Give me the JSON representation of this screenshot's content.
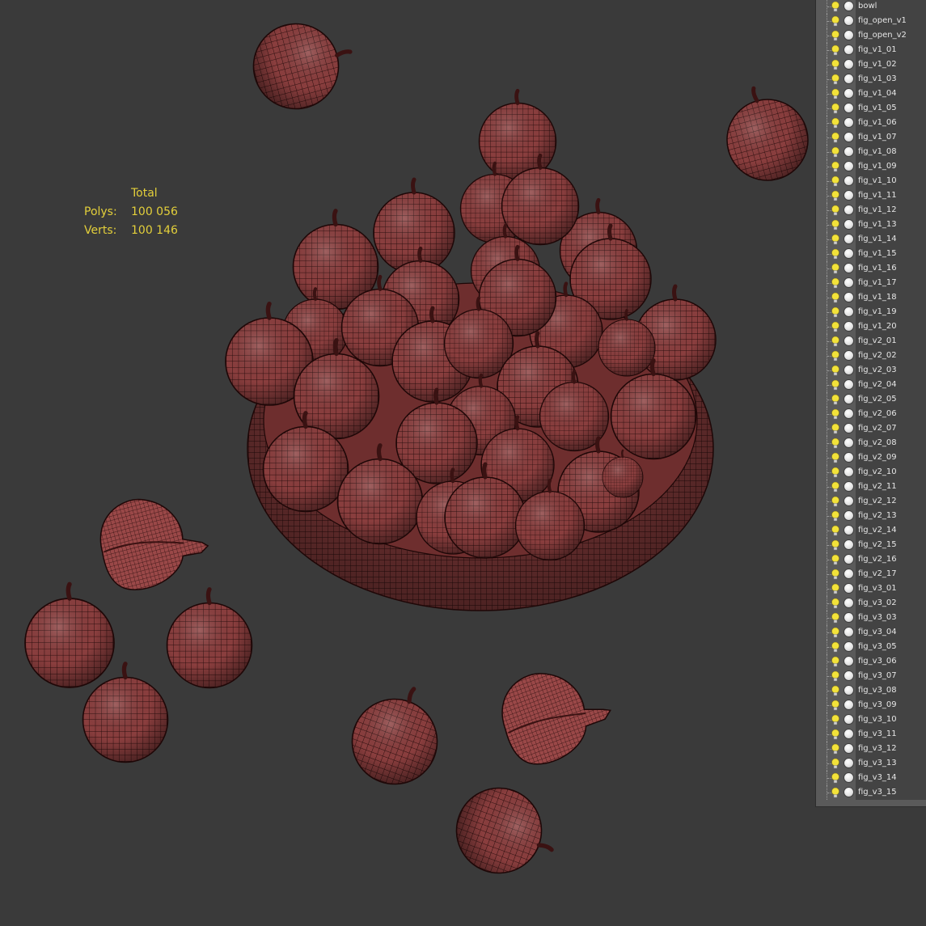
{
  "stats": {
    "header": "Total",
    "polys_label": "Polys:",
    "polys_value": "100 056",
    "verts_label": "Verts:",
    "verts_value": "100 146"
  },
  "colors": {
    "background": "#3a3a3a",
    "stats_text": "#e3cf3a",
    "wire_fill": "#8a3e3e",
    "wire_line": "#2a0d0d",
    "bulb": "#f2e23a"
  },
  "layers": [
    {
      "name": "bowl",
      "icon": "bulb-icon",
      "visible": true
    },
    {
      "name": "fig_open_v1",
      "icon": "bulb-icon",
      "visible": true
    },
    {
      "name": "fig_open_v2",
      "icon": "bulb-icon",
      "visible": true
    },
    {
      "name": "fig_v1_01",
      "icon": "bulb-icon",
      "visible": true
    },
    {
      "name": "fig_v1_02",
      "icon": "bulb-icon",
      "visible": true
    },
    {
      "name": "fig_v1_03",
      "icon": "bulb-icon",
      "visible": true
    },
    {
      "name": "fig_v1_04",
      "icon": "bulb-icon",
      "visible": true
    },
    {
      "name": "fig_v1_05",
      "icon": "bulb-icon",
      "visible": true
    },
    {
      "name": "fig_v1_06",
      "icon": "bulb-icon",
      "visible": true
    },
    {
      "name": "fig_v1_07",
      "icon": "bulb-icon",
      "visible": true
    },
    {
      "name": "fig_v1_08",
      "icon": "bulb-icon",
      "visible": true
    },
    {
      "name": "fig_v1_09",
      "icon": "bulb-icon",
      "visible": true
    },
    {
      "name": "fig_v1_10",
      "icon": "bulb-icon",
      "visible": true
    },
    {
      "name": "fig_v1_11",
      "icon": "bulb-icon",
      "visible": true
    },
    {
      "name": "fig_v1_12",
      "icon": "bulb-icon",
      "visible": true
    },
    {
      "name": "fig_v1_13",
      "icon": "bulb-icon",
      "visible": true
    },
    {
      "name": "fig_v1_14",
      "icon": "bulb-icon",
      "visible": true
    },
    {
      "name": "fig_v1_15",
      "icon": "bulb-icon",
      "visible": true
    },
    {
      "name": "fig_v1_16",
      "icon": "bulb-icon",
      "visible": true
    },
    {
      "name": "fig_v1_17",
      "icon": "bulb-icon",
      "visible": true
    },
    {
      "name": "fig_v1_18",
      "icon": "bulb-icon",
      "visible": true
    },
    {
      "name": "fig_v1_19",
      "icon": "bulb-icon",
      "visible": true
    },
    {
      "name": "fig_v1_20",
      "icon": "bulb-icon",
      "visible": true
    },
    {
      "name": "fig_v2_01",
      "icon": "bulb-icon",
      "visible": true
    },
    {
      "name": "fig_v2_02",
      "icon": "bulb-icon",
      "visible": true
    },
    {
      "name": "fig_v2_03",
      "icon": "bulb-icon",
      "visible": true
    },
    {
      "name": "fig_v2_04",
      "icon": "bulb-icon",
      "visible": true
    },
    {
      "name": "fig_v2_05",
      "icon": "bulb-icon",
      "visible": true
    },
    {
      "name": "fig_v2_06",
      "icon": "bulb-icon",
      "visible": true
    },
    {
      "name": "fig_v2_07",
      "icon": "bulb-icon",
      "visible": true
    },
    {
      "name": "fig_v2_08",
      "icon": "bulb-icon",
      "visible": true
    },
    {
      "name": "fig_v2_09",
      "icon": "bulb-icon",
      "visible": true
    },
    {
      "name": "fig_v2_10",
      "icon": "bulb-icon",
      "visible": true
    },
    {
      "name": "fig_v2_11",
      "icon": "bulb-icon",
      "visible": true
    },
    {
      "name": "fig_v2_12",
      "icon": "bulb-icon",
      "visible": true
    },
    {
      "name": "fig_v2_13",
      "icon": "bulb-icon",
      "visible": true
    },
    {
      "name": "fig_v2_14",
      "icon": "bulb-icon",
      "visible": true
    },
    {
      "name": "fig_v2_15",
      "icon": "bulb-icon",
      "visible": true
    },
    {
      "name": "fig_v2_16",
      "icon": "bulb-icon",
      "visible": true
    },
    {
      "name": "fig_v2_17",
      "icon": "bulb-icon",
      "visible": true
    },
    {
      "name": "fig_v3_01",
      "icon": "bulb-icon",
      "visible": true
    },
    {
      "name": "fig_v3_02",
      "icon": "bulb-icon",
      "visible": true
    },
    {
      "name": "fig_v3_03",
      "icon": "bulb-icon",
      "visible": true
    },
    {
      "name": "fig_v3_04",
      "icon": "bulb-icon",
      "visible": true
    },
    {
      "name": "fig_v3_05",
      "icon": "bulb-icon",
      "visible": true
    },
    {
      "name": "fig_v3_06",
      "icon": "bulb-icon",
      "visible": true
    },
    {
      "name": "fig_v3_07",
      "icon": "bulb-icon",
      "visible": true
    },
    {
      "name": "fig_v3_08",
      "icon": "bulb-icon",
      "visible": true
    },
    {
      "name": "fig_v3_09",
      "icon": "bulb-icon",
      "visible": true
    },
    {
      "name": "fig_v3_10",
      "icon": "bulb-icon",
      "visible": true
    },
    {
      "name": "fig_v3_11",
      "icon": "bulb-icon",
      "visible": true
    },
    {
      "name": "fig_v3_12",
      "icon": "bulb-icon",
      "visible": true
    },
    {
      "name": "fig_v3_13",
      "icon": "bulb-icon",
      "visible": true
    },
    {
      "name": "fig_v3_14",
      "icon": "bulb-icon",
      "visible": true
    },
    {
      "name": "fig_v3_15",
      "icon": "bulb-icon",
      "visible": true
    }
  ]
}
